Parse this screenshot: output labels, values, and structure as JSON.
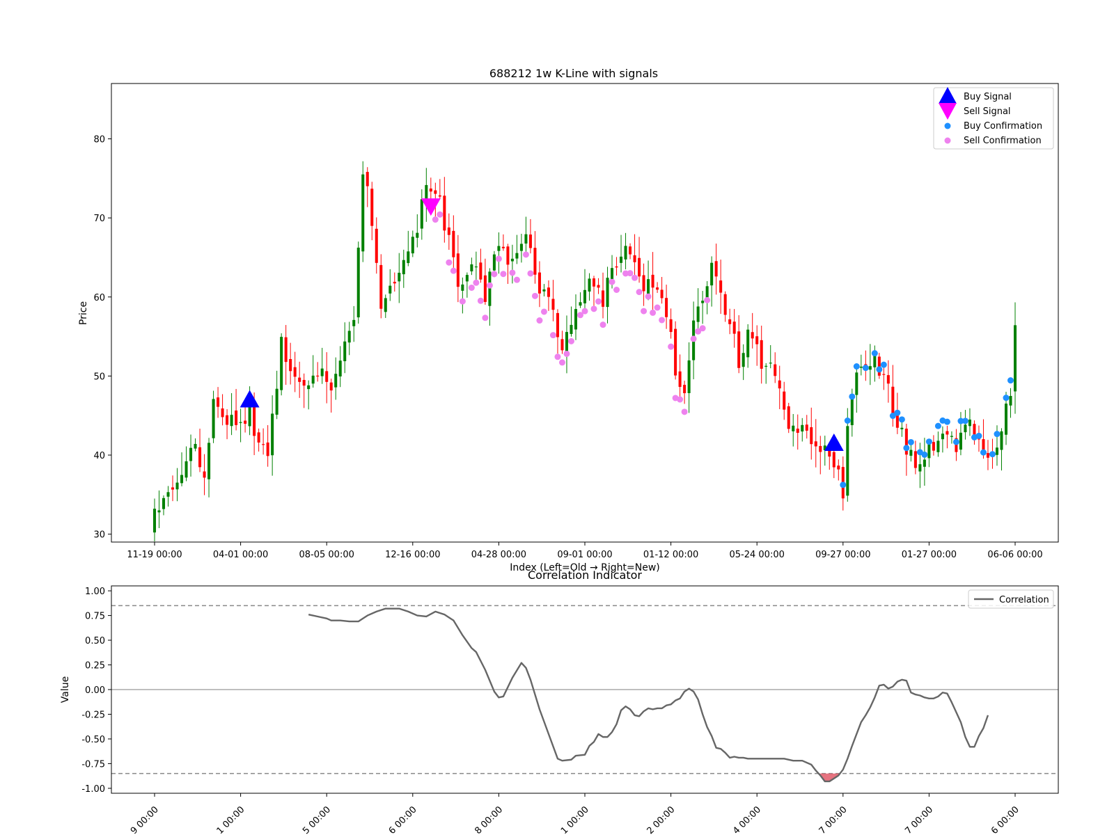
{
  "chart_data": [
    {
      "type": "candlestick",
      "title": "688212 1w K-Line with signals",
      "xlabel": "Index (Left=Old → Right=New)",
      "ylabel": "Price",
      "ylim": [
        29,
        87
      ],
      "yticks": [
        30,
        40,
        50,
        60,
        70,
        80
      ],
      "xticks": [
        {
          "i": 0,
          "label": "11-19 00:00"
        },
        {
          "i": 19,
          "label": "04-01 00:00"
        },
        {
          "i": 38,
          "label": "08-05 00:00"
        },
        {
          "i": 57,
          "label": "12-16 00:00"
        },
        {
          "i": 76,
          "label": "04-28 00:00"
        },
        {
          "i": 95,
          "label": "09-01 00:00"
        },
        {
          "i": 114,
          "label": "01-12 00:00"
        },
        {
          "i": 133,
          "label": "05-24 00:00"
        },
        {
          "i": 152,
          "label": "09-27 00:00"
        },
        {
          "i": 171,
          "label": "01-27 00:00"
        },
        {
          "i": 190,
          "label": "06-06 00:00"
        }
      ],
      "legend_position": "top-right",
      "legend": [
        {
          "label": "Buy Signal",
          "marker": "triangle-up",
          "color": "#0000ff"
        },
        {
          "label": "Sell Signal",
          "marker": "triangle-down",
          "color": "#ff00ff"
        },
        {
          "label": "Buy Confirmation",
          "marker": "circle",
          "color": "#1e90ff"
        },
        {
          "label": "Sell Confirmation",
          "marker": "circle",
          "color": "#ee82ee"
        }
      ],
      "colors": {
        "up": "#008000",
        "down": "#ff0000"
      },
      "price_anchors": [
        [
          0,
          33
        ],
        [
          3,
          36
        ],
        [
          6,
          37
        ],
        [
          9,
          42
        ],
        [
          11,
          37
        ],
        [
          13,
          46
        ],
        [
          16,
          44
        ],
        [
          19,
          44
        ],
        [
          21,
          46
        ],
        [
          23,
          41
        ],
        [
          25,
          40
        ],
        [
          28,
          54
        ],
        [
          30,
          50
        ],
        [
          34,
          48
        ],
        [
          36,
          51
        ],
        [
          39,
          48
        ],
        [
          42,
          54
        ],
        [
          44,
          58
        ],
        [
          46,
          76
        ],
        [
          48,
          70
        ],
        [
          50,
          59
        ],
        [
          52,
          61
        ],
        [
          55,
          64
        ],
        [
          58,
          68
        ],
        [
          60,
          75
        ],
        [
          63,
          72
        ],
        [
          65,
          67
        ],
        [
          67,
          61
        ],
        [
          70,
          65
        ],
        [
          73,
          60
        ],
        [
          76,
          67
        ],
        [
          79,
          64
        ],
        [
          82,
          68
        ],
        [
          85,
          61
        ],
        [
          88,
          58
        ],
        [
          90,
          53
        ],
        [
          92,
          56
        ],
        [
          94,
          60
        ],
        [
          96,
          63
        ],
        [
          99,
          59
        ],
        [
          101,
          64
        ],
        [
          104,
          66
        ],
        [
          107,
          62
        ],
        [
          110,
          61
        ],
        [
          113,
          58
        ],
        [
          115,
          51
        ],
        [
          117,
          48
        ],
        [
          119,
          58
        ],
        [
          121,
          60
        ],
        [
          123,
          64
        ],
        [
          125,
          60
        ],
        [
          127,
          57
        ],
        [
          129,
          52
        ],
        [
          131,
          55
        ],
        [
          134,
          52
        ],
        [
          137,
          50
        ],
        [
          140,
          44
        ],
        [
          143,
          43
        ],
        [
          146,
          42
        ],
        [
          149,
          40
        ],
        [
          151,
          39
        ],
        [
          152,
          34
        ],
        [
          153,
          44
        ],
        [
          155,
          50
        ],
        [
          158,
          52
        ],
        [
          160,
          51
        ],
        [
          162,
          48
        ],
        [
          164,
          44
        ],
        [
          166,
          41
        ],
        [
          168,
          39
        ],
        [
          171,
          41
        ],
        [
          174,
          42
        ],
        [
          177,
          41
        ],
        [
          180,
          44
        ],
        [
          183,
          41
        ],
        [
          185,
          39
        ],
        [
          187,
          44
        ],
        [
          189,
          48
        ],
        [
          190,
          56
        ]
      ],
      "buy_signals": [
        {
          "i": 21,
          "price": 47
        },
        {
          "i": 150,
          "price": 41.5
        }
      ],
      "sell_signals": [
        {
          "i": 61,
          "price": 71.5
        }
      ],
      "buy_confirmation": {
        "from": 152,
        "to": 190,
        "offset": 1.0
      },
      "sell_confirmation": {
        "from": 62,
        "to": 122,
        "offset": -2.5
      }
    },
    {
      "type": "line",
      "title": "Correlation Indicator",
      "xlabel": "",
      "ylabel": "Value",
      "ylim": [
        -1.05,
        1.05
      ],
      "yticks": [
        -1.0,
        -0.75,
        -0.5,
        -0.25,
        0.0,
        0.25,
        0.5,
        0.75,
        1.0
      ],
      "xtick_labels": [
        "9 00:00",
        "1 00:00",
        "5 00:00",
        "6 00:00",
        "8 00:00",
        "1 00:00",
        "2 00:00",
        "4 00:00",
        "7 00:00",
        "7 00:00",
        "6 00:00"
      ],
      "thresholds": [
        0.85,
        -0.85
      ],
      "zero_line": 0,
      "legend_position": "top-right",
      "series": [
        {
          "name": "Correlation",
          "color": "#666666",
          "points": [
            [
              34,
              0.76
            ],
            [
              36,
              0.74
            ],
            [
              38,
              0.72
            ],
            [
              39,
              0.7
            ],
            [
              41,
              0.7
            ],
            [
              43,
              0.69
            ],
            [
              45,
              0.69
            ],
            [
              47,
              0.75
            ],
            [
              49,
              0.79
            ],
            [
              51,
              0.82
            ],
            [
              54,
              0.82
            ],
            [
              56,
              0.79
            ],
            [
              58,
              0.75
            ],
            [
              60,
              0.74
            ],
            [
              62,
              0.79
            ],
            [
              64,
              0.76
            ],
            [
              66,
              0.7
            ],
            [
              68,
              0.55
            ],
            [
              70,
              0.42
            ],
            [
              71,
              0.38
            ],
            [
              73,
              0.2
            ],
            [
              75,
              -0.02
            ],
            [
              76,
              -0.08
            ],
            [
              77,
              -0.07
            ],
            [
              79,
              0.12
            ],
            [
              81,
              0.27
            ],
            [
              82,
              0.22
            ],
            [
              83,
              0.1
            ],
            [
              85,
              -0.2
            ],
            [
              87,
              -0.45
            ],
            [
              89,
              -0.7
            ],
            [
              90,
              -0.72
            ],
            [
              92,
              -0.71
            ],
            [
              93,
              -0.67
            ],
            [
              95,
              -0.66
            ],
            [
              96,
              -0.57
            ],
            [
              97,
              -0.53
            ],
            [
              98,
              -0.45
            ],
            [
              99,
              -0.48
            ],
            [
              100,
              -0.48
            ],
            [
              101,
              -0.43
            ],
            [
              102,
              -0.35
            ],
            [
              103,
              -0.21
            ],
            [
              104,
              -0.17
            ],
            [
              105,
              -0.2
            ],
            [
              106,
              -0.26
            ],
            [
              107,
              -0.27
            ],
            [
              108,
              -0.22
            ],
            [
              109,
              -0.19
            ],
            [
              110,
              -0.2
            ],
            [
              111,
              -0.19
            ],
            [
              112,
              -0.19
            ],
            [
              113,
              -0.16
            ],
            [
              114,
              -0.15
            ],
            [
              115,
              -0.11
            ],
            [
              116,
              -0.09
            ],
            [
              117,
              -0.02
            ],
            [
              118,
              0.01
            ],
            [
              119,
              -0.02
            ],
            [
              120,
              -0.1
            ],
            [
              121,
              -0.25
            ],
            [
              122,
              -0.38
            ],
            [
              123,
              -0.47
            ],
            [
              124,
              -0.59
            ],
            [
              125,
              -0.6
            ],
            [
              126,
              -0.64
            ],
            [
              127,
              -0.69
            ],
            [
              128,
              -0.68
            ],
            [
              129,
              -0.69
            ],
            [
              130,
              -0.69
            ],
            [
              131,
              -0.7
            ],
            [
              133,
              -0.7
            ],
            [
              135,
              -0.7
            ],
            [
              137,
              -0.7
            ],
            [
              139,
              -0.7
            ],
            [
              141,
              -0.72
            ],
            [
              143,
              -0.72
            ],
            [
              145,
              -0.76
            ],
            [
              146,
              -0.82
            ],
            [
              147,
              -0.87
            ],
            [
              148,
              -0.93
            ],
            [
              149,
              -0.93
            ],
            [
              150,
              -0.9
            ],
            [
              151,
              -0.87
            ],
            [
              152,
              -0.81
            ],
            [
              153,
              -0.7
            ],
            [
              154,
              -0.57
            ],
            [
              155,
              -0.45
            ],
            [
              156,
              -0.33
            ],
            [
              157,
              -0.26
            ],
            [
              158,
              -0.18
            ],
            [
              159,
              -0.08
            ],
            [
              160,
              0.04
            ],
            [
              161,
              0.05
            ],
            [
              162,
              0.01
            ],
            [
              163,
              0.03
            ],
            [
              164,
              0.08
            ],
            [
              165,
              0.1
            ],
            [
              166,
              0.09
            ],
            [
              167,
              -0.03
            ],
            [
              168,
              -0.05
            ],
            [
              169,
              -0.06
            ],
            [
              170,
              -0.08
            ],
            [
              171,
              -0.09
            ],
            [
              172,
              -0.09
            ],
            [
              173,
              -0.07
            ],
            [
              174,
              -0.03
            ],
            [
              175,
              -0.04
            ],
            [
              176,
              -0.13
            ],
            [
              177,
              -0.23
            ],
            [
              178,
              -0.33
            ],
            [
              179,
              -0.48
            ],
            [
              180,
              -0.58
            ],
            [
              181,
              -0.58
            ],
            [
              182,
              -0.47
            ],
            [
              183,
              -0.39
            ],
            [
              184,
              -0.26
            ]
          ]
        }
      ]
    }
  ]
}
